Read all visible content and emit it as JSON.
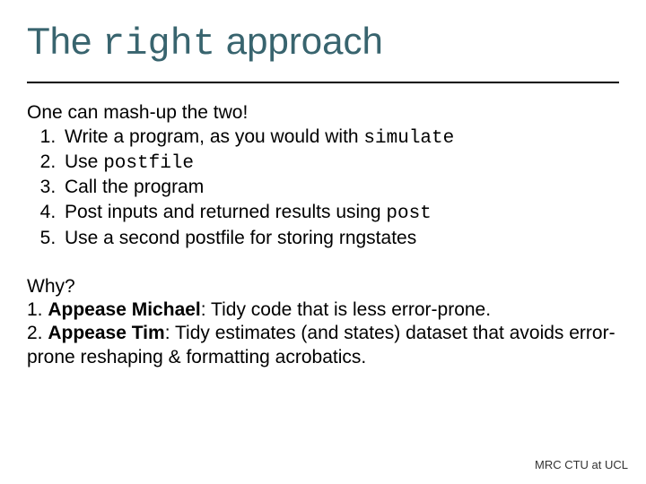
{
  "title": {
    "prefix": "The ",
    "mono": "right",
    "suffix": " approach"
  },
  "intro": "One can mash-up the two!",
  "steps": [
    {
      "pre": "Write a program, as you would with ",
      "code": "simulate",
      "post": ""
    },
    {
      "pre": "Use ",
      "code": "postfile",
      "post": ""
    },
    {
      "pre": "Call the program",
      "code": "",
      "post": ""
    },
    {
      "pre": "Post inputs and returned results using ",
      "code": "post",
      "post": ""
    },
    {
      "pre": "Use a second postfile for storing rngstates",
      "code": "",
      "post": ""
    }
  ],
  "why": {
    "heading": "Why?",
    "reasons": [
      {
        "num": "1. ",
        "bold": "Appease Michael",
        "rest": ": Tidy code that is less error-prone."
      },
      {
        "num": "2. ",
        "bold": "Appease Tim",
        "rest": ": Tidy estimates (and states) dataset that avoids error-prone reshaping & formatting acrobatics."
      }
    ]
  },
  "footer": "MRC CTU at UCL"
}
